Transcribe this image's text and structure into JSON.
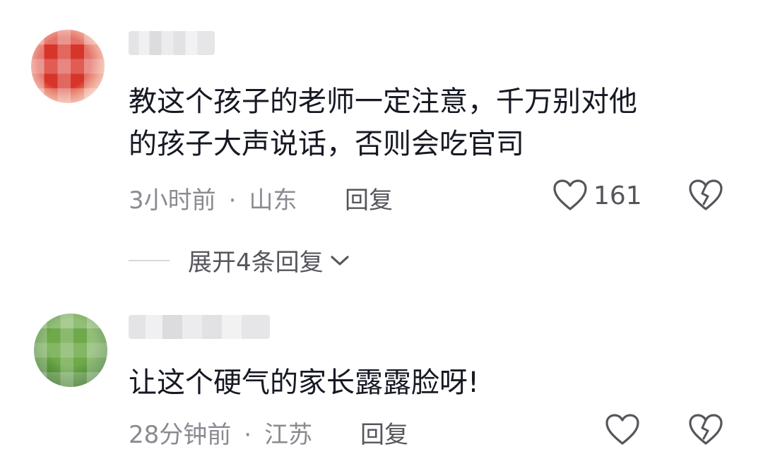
{
  "comments": [
    {
      "text_lines": [
        "教这个孩子的老师一定注意，千万别对他",
        "的孩子大声说话，否则会吃官司"
      ],
      "time": "3小时前",
      "separator": "·",
      "location": "山东",
      "reply_label": "回复",
      "like_count": "161",
      "expand_label": "展开4条回复"
    },
    {
      "text_lines": [
        "让这个硬气的家长露露脸呀!"
      ],
      "time": "28分钟前",
      "separator": "·",
      "location": "江苏",
      "reply_label": "回复"
    }
  ],
  "colors": {
    "text": "#161823",
    "meta": "#8a8b91",
    "action": "#55565c"
  },
  "icons": {
    "like": "heart-outline-icon",
    "dislike": "broken-heart-icon",
    "expand": "chevron-down-icon"
  }
}
